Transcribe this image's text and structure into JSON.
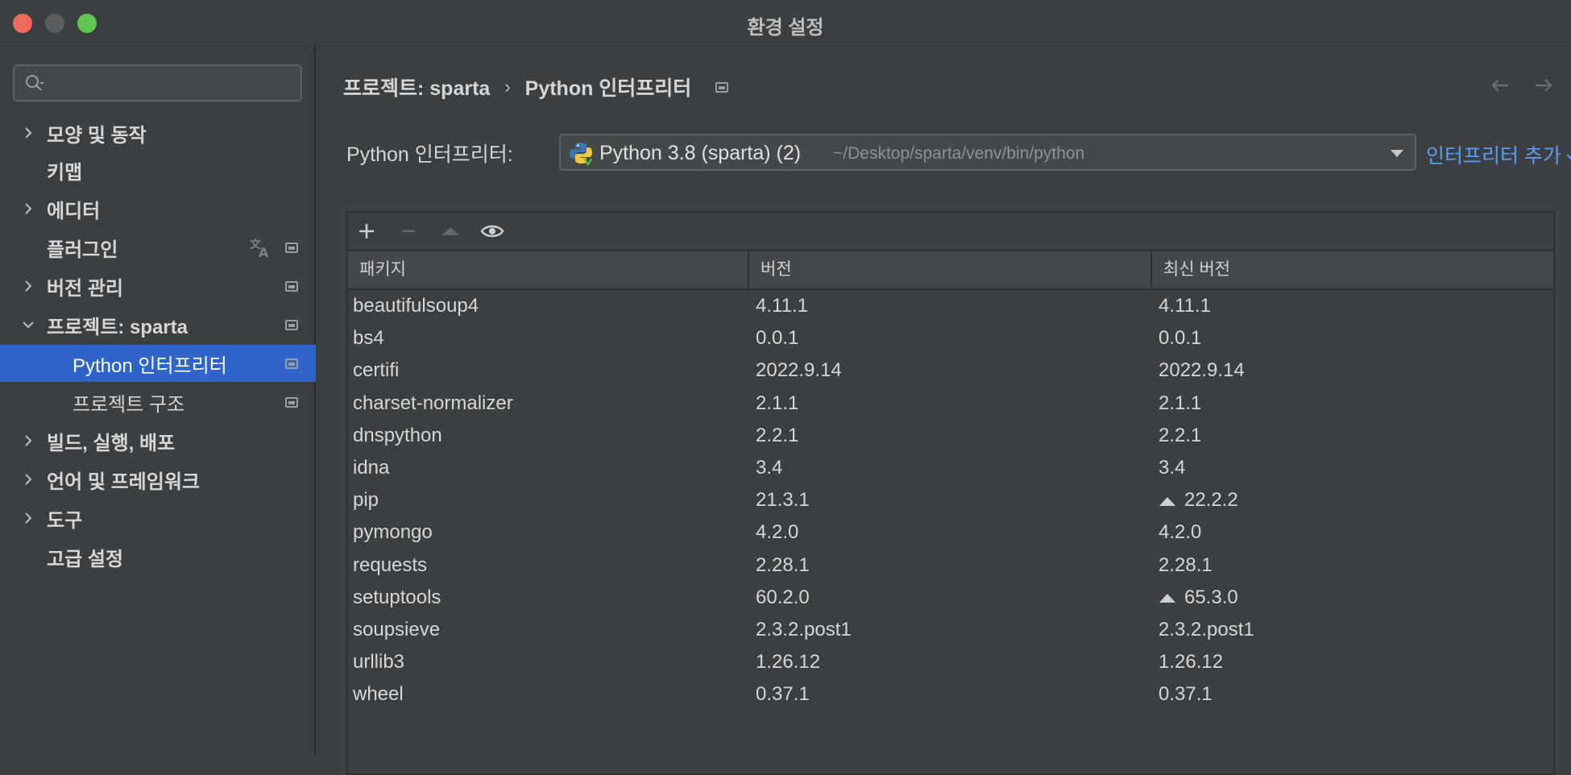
{
  "window": {
    "title": "환경 설정"
  },
  "sidebar": {
    "search": {
      "placeholder": ""
    },
    "items": [
      {
        "label": "모양 및 동작",
        "expandable": true,
        "expanded": false
      },
      {
        "label": "키맵",
        "expandable": false
      },
      {
        "label": "에디터",
        "expandable": true,
        "expanded": false
      },
      {
        "label": "플러그인",
        "expandable": false
      },
      {
        "label": "버전 관리",
        "expandable": true,
        "expanded": false
      },
      {
        "label": "프로젝트: sparta",
        "expandable": true,
        "expanded": true
      },
      {
        "label": "Python 인터프리터",
        "sub": true,
        "selected": true
      },
      {
        "label": "프로젝트 구조",
        "sub": true
      },
      {
        "label": "빌드, 실행, 배포",
        "expandable": true,
        "expanded": false
      },
      {
        "label": "언어 및 프레임워크",
        "expandable": true,
        "expanded": false
      },
      {
        "label": "도구",
        "expandable": true,
        "expanded": false
      },
      {
        "label": "고급 설정",
        "expandable": false
      }
    ]
  },
  "breadcrumb": {
    "parent": "프로젝트: sparta",
    "separator": "›",
    "current": "Python 인터프리터"
  },
  "interpreter": {
    "label": "Python 인터프리터:",
    "name": "Python 3.8 (sparta) (2)",
    "path": "~/Desktop/sparta/venv/bin/python",
    "add_label": "인터프리터 추가"
  },
  "table": {
    "columns": [
      "패키지",
      "버전",
      "최신 버전"
    ],
    "rows": [
      {
        "package": "beautifulsoup4",
        "version": "4.11.1",
        "latest": "4.11.1",
        "upgrade": false
      },
      {
        "package": "bs4",
        "version": "0.0.1",
        "latest": "0.0.1",
        "upgrade": false
      },
      {
        "package": "certifi",
        "version": "2022.9.14",
        "latest": "2022.9.14",
        "upgrade": false
      },
      {
        "package": "charset-normalizer",
        "version": "2.1.1",
        "latest": "2.1.1",
        "upgrade": false
      },
      {
        "package": "dnspython",
        "version": "2.2.1",
        "latest": "2.2.1",
        "upgrade": false
      },
      {
        "package": "idna",
        "version": "3.4",
        "latest": "3.4",
        "upgrade": false
      },
      {
        "package": "pip",
        "version": "21.3.1",
        "latest": "22.2.2",
        "upgrade": true
      },
      {
        "package": "pymongo",
        "version": "4.2.0",
        "latest": "4.2.0",
        "upgrade": false
      },
      {
        "package": "requests",
        "version": "2.28.1",
        "latest": "2.28.1",
        "upgrade": false
      },
      {
        "package": "setuptools",
        "version": "60.2.0",
        "latest": "65.3.0",
        "upgrade": true
      },
      {
        "package": "soupsieve",
        "version": "2.3.2.post1",
        "latest": "2.3.2.post1",
        "upgrade": false
      },
      {
        "package": "urllib3",
        "version": "1.26.12",
        "latest": "1.26.12",
        "upgrade": false
      },
      {
        "package": "wheel",
        "version": "0.37.1",
        "latest": "0.37.1",
        "upgrade": false
      }
    ]
  },
  "icons": {
    "search": "search-icon",
    "chevron_right": "chevron-right-icon",
    "chevron_down": "chevron-down-icon",
    "page": "page-icon",
    "translate": "translate-icon",
    "python": "python-icon",
    "add": "plus-icon",
    "remove": "minus-icon",
    "upgrade": "upgrade-arrow-icon",
    "show": "eye-icon",
    "back": "arrow-left-icon",
    "forward": "arrow-right-icon"
  },
  "colors": {
    "background": "#3c3f41",
    "selection": "#2f65ca",
    "link": "#5b9cf4",
    "text": "#d6d6d6",
    "close": "#ed6a5e",
    "zoom": "#61c554"
  }
}
